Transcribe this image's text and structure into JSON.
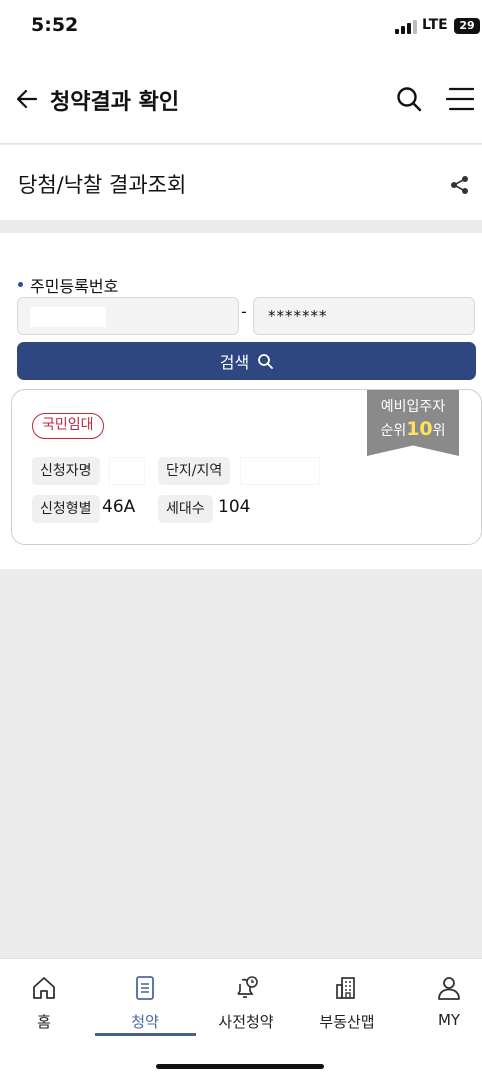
{
  "status_bar": {
    "time": "5:52",
    "network": "LTE",
    "battery": "29"
  },
  "header": {
    "back_icon": "arrow-left-icon",
    "title": "청약결과 확인",
    "search_icon": "search-icon",
    "menu_icon": "hamburger-menu-icon"
  },
  "section": {
    "title": "당첨/낙찰 결과조회",
    "share_icon": "share-icon"
  },
  "form": {
    "field_label": "주민등록번호",
    "rrn_front_value": "",
    "separator": "-",
    "rrn_back_value": "*******",
    "search_button_label": "검색"
  },
  "result": {
    "type_badge": "국민임대",
    "ribbon_line1": "예비입주자",
    "ribbon_prefix": "순위",
    "rank": "10",
    "ribbon_suffix": "위",
    "applicant_label": "신청자명",
    "applicant_value": "",
    "complex_label": "단지/지역",
    "complex_value": "",
    "unit_type_label": "신청형별",
    "unit_type_value": "46A",
    "households_label": "세대수",
    "households_value": "104"
  },
  "tab_bar": {
    "active_tab": "청약",
    "tabs": [
      {
        "label": "홈",
        "icon": "home-icon"
      },
      {
        "label": "청약",
        "icon": "document-icon"
      },
      {
        "label": "사전청약",
        "icon": "bell-clock-icon"
      },
      {
        "label": "부동산맵",
        "icon": "building-map-icon"
      },
      {
        "label": "MY",
        "icon": "person-icon"
      }
    ]
  }
}
